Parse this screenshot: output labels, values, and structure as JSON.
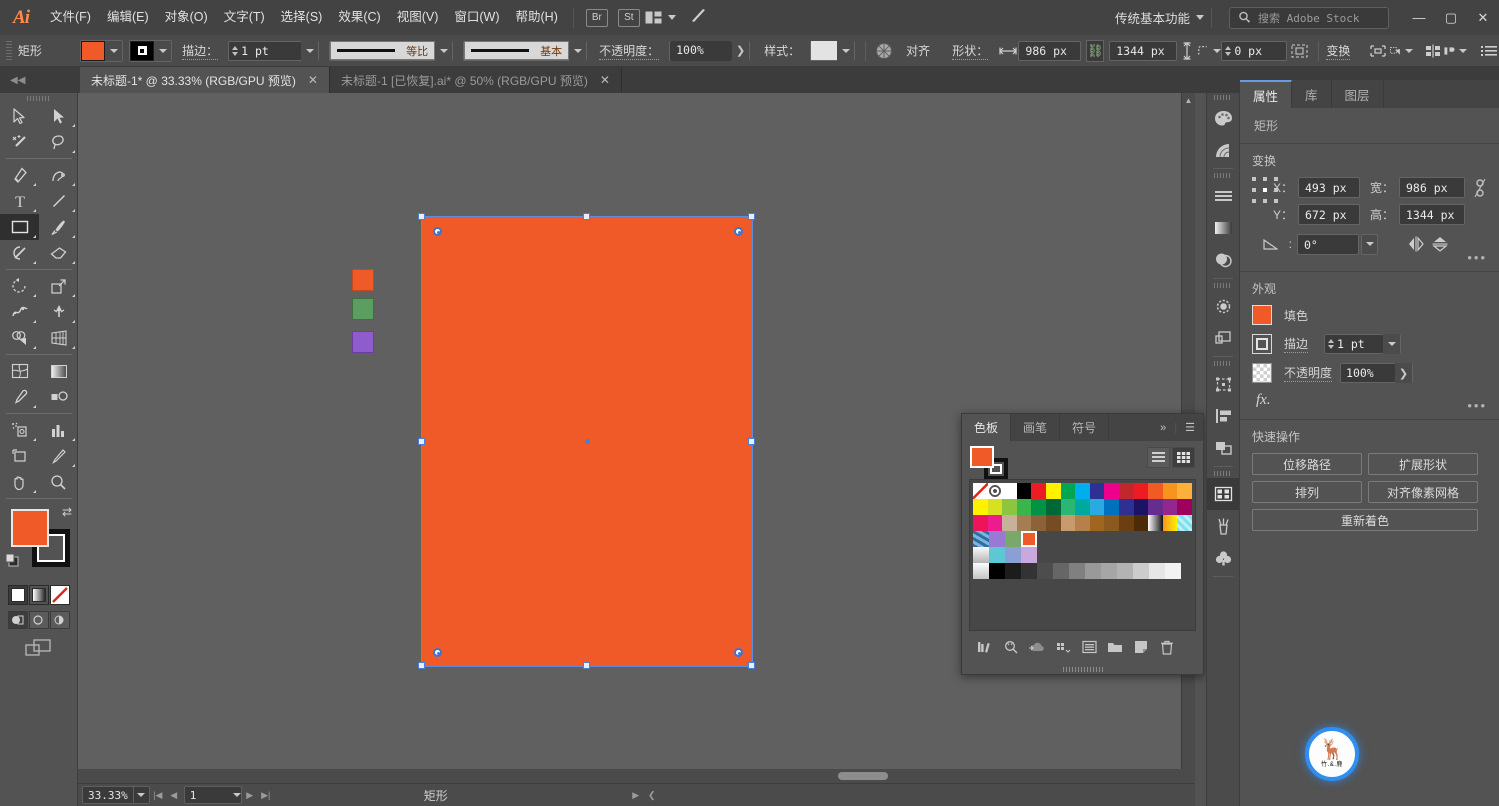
{
  "app": {
    "logo": "Ai",
    "menus": [
      "文件(F)",
      "编辑(E)",
      "对象(O)",
      "文字(T)",
      "选择(S)",
      "效果(C)",
      "视图(V)",
      "窗口(W)",
      "帮助(H)"
    ],
    "quick_buttons": [
      "Br",
      "St"
    ],
    "workspace": "传统基本功能",
    "search_placeholder": "搜索 Adobe Stock",
    "window_buttons": {
      "minimize": "—",
      "maximize": "▢",
      "close": "✕"
    }
  },
  "control_bar": {
    "object_label": "矩形",
    "fill_color": "#f05a28",
    "stroke_swatch_label": "stroke-swatch",
    "stroke_label": "描边：",
    "stroke_weight": "1 pt",
    "profile_variable": "等比",
    "brush_definition": "基本",
    "opacity_label": "不透明度：",
    "opacity_value": "100%",
    "style_label": "样式：",
    "align_label": "对齐",
    "shape_label": "形状：",
    "width_value": "986 px",
    "height_value": "1344 px",
    "corner_value": "0 px",
    "transform_label": "变换"
  },
  "tabs": [
    {
      "title": "未标题-1* @ 33.33% (RGB/GPU 预览)",
      "active": true,
      "close": "✕"
    },
    {
      "title": "未标题-1 [已恢复].ai* @ 50% (RGB/GPU 预览)",
      "active": false,
      "close": "✕"
    }
  ],
  "toolbar": {
    "tools": [
      {
        "name": "selection-tool",
        "glyph": "selection"
      },
      {
        "name": "direct-selection-tool",
        "glyph": "direct-selection"
      },
      {
        "name": "magic-wand-tool",
        "glyph": "magic-wand"
      },
      {
        "name": "lasso-tool",
        "glyph": "lasso"
      },
      {
        "name": "pen-tool",
        "glyph": "pen"
      },
      {
        "name": "curvature-tool",
        "glyph": "curvature"
      },
      {
        "name": "type-tool",
        "glyph": "type"
      },
      {
        "name": "line-segment-tool",
        "glyph": "line"
      },
      {
        "name": "rectangle-tool",
        "glyph": "rectangle",
        "selected": true
      },
      {
        "name": "paintbrush-tool",
        "glyph": "paintbrush"
      },
      {
        "name": "shaper-tool",
        "glyph": "shaper"
      },
      {
        "name": "eraser-tool",
        "glyph": "eraser"
      },
      {
        "name": "rotate-tool",
        "glyph": "rotate"
      },
      {
        "name": "scale-tool",
        "glyph": "scale"
      },
      {
        "name": "width-tool",
        "glyph": "width"
      },
      {
        "name": "free-transform-tool",
        "glyph": "free-transform"
      },
      {
        "name": "shape-builder-tool",
        "glyph": "shape-builder"
      },
      {
        "name": "perspective-grid-tool",
        "glyph": "perspective-grid"
      },
      {
        "name": "mesh-tool",
        "glyph": "mesh"
      },
      {
        "name": "gradient-tool",
        "glyph": "gradient"
      },
      {
        "name": "eyedropper-tool",
        "glyph": "eyedropper"
      },
      {
        "name": "blend-tool",
        "glyph": "blend"
      },
      {
        "name": "symbol-sprayer-tool",
        "glyph": "symbol-sprayer"
      },
      {
        "name": "column-graph-tool",
        "glyph": "column-graph"
      },
      {
        "name": "artboard-tool",
        "glyph": "artboard"
      },
      {
        "name": "slice-tool",
        "glyph": "slice"
      },
      {
        "name": "hand-tool",
        "glyph": "hand"
      },
      {
        "name": "zoom-tool",
        "glyph": "zoom"
      }
    ],
    "fill_color": "#f05a28",
    "stroke_color": "#111111",
    "color_modes": [
      "color",
      "gradient",
      "none"
    ],
    "draw_modes": [
      "draw-normal",
      "draw-behind",
      "draw-inside"
    ]
  },
  "canvas": {
    "shape_fill": "#f05a28",
    "selection_color": "#4c7fd4",
    "mini_swatches": [
      {
        "name": "mini-swatch-orange",
        "color": "#f05a28"
      },
      {
        "name": "mini-swatch-green",
        "color": "#5b9e5f"
      },
      {
        "name": "mini-swatch-purple",
        "color": "#8e5ccd"
      }
    ]
  },
  "status_bar": {
    "zoom": "33.33%",
    "page": "1",
    "tool_name": "矩形"
  },
  "swatches_panel": {
    "tabs": [
      "色板",
      "画笔",
      "符号"
    ],
    "active_tab": "色板",
    "fill_color": "#f05a28",
    "selected_swatch": "#f05a28",
    "rows": [
      [
        "none",
        "registration",
        "#ffffff",
        "#000000",
        "#ed1c24",
        "#fff200",
        "#00a651",
        "#00aeef",
        "#2e3192",
        "#ec008c",
        "#c1272d",
        "#ed1c24",
        "#f15a24",
        "#f7941e",
        "#fbb03b"
      ],
      [
        "#fff200",
        "#d9e021",
        "#8cc63f",
        "#39b54a",
        "#009245",
        "#006837",
        "#2bb673",
        "#00a99d",
        "#29abe2",
        "#0071bc",
        "#2e3192",
        "#1b1464",
        "#662d91",
        "#92278f",
        "#9e005d"
      ],
      [
        "#ed145b",
        "#ec1c8c",
        "#c7b299",
        "#a67c52",
        "#8c6239",
        "#754c24",
        "#c69c6d",
        "#b5804a",
        "#a0651f",
        "#8a5a1e",
        "#6b3f10",
        "#4c2c08",
        "gradient-white-black",
        "gradient-orange",
        "pattern-aqua"
      ],
      [
        "pattern-blue-texture",
        "#9a79d4",
        "#7aa86b",
        "#f05a28"
      ],
      [
        "gradient-grey",
        "#5cc8d1",
        "#8c9ed6",
        "#c9a8dd"
      ],
      [
        "gradient-light",
        "#000000",
        "#1c1c1c",
        "#333333",
        "#4d4d4d",
        "#666666",
        "#808080",
        "#999999",
        "#a6a6a6",
        "#b3b3b3",
        "#cccccc",
        "#e6e6e6",
        "#f2f2f2"
      ]
    ],
    "footer_icons": [
      "swatch-libraries-icon",
      "color-group-icon",
      "cc-libraries-icon",
      "show-swatch-kinds-icon",
      "swatch-options-icon",
      "new-color-group-icon",
      "new-swatch-icon",
      "delete-swatch-icon"
    ]
  },
  "rail": {
    "groups": [
      [
        "color-icon",
        "color-guide-icon"
      ],
      [
        "stroke-icon",
        "gradient-icon",
        "transparency-icon"
      ],
      [
        "appearance-icon",
        "layers-stack-icon"
      ],
      [
        "transform-icon",
        "align-icon",
        "pathfinder-icon"
      ],
      [
        "swatches-icon",
        "brushes-icon",
        "symbols-icon"
      ]
    ]
  },
  "properties": {
    "tabs": [
      "属性",
      "库",
      "图层"
    ],
    "active_tab": "属性",
    "subject": "矩形",
    "transform": {
      "title": "变换",
      "x_label": "X：",
      "x_value": "493 px",
      "y_label": "Y：",
      "y_value": "672 px",
      "w_label": "宽：",
      "w_value": "986 px",
      "h_label": "高：",
      "h_value": "1344 px",
      "angle_value": "0°",
      "more": "•••"
    },
    "appearance": {
      "title": "外观",
      "fill_label": "填色",
      "fill_color": "#f05a28",
      "stroke_label": "描边",
      "stroke_weight": "1 pt",
      "opacity_label": "不透明度",
      "opacity_value": "100%",
      "fx_label": "fx.",
      "more": "•••"
    },
    "quick_actions": {
      "title": "快速操作",
      "buttons": [
        "位移路径",
        "扩展形状",
        "排列",
        "对齐像素网格",
        "重新着色"
      ]
    }
  },
  "watermark": {
    "text": "竹.&.鹿"
  }
}
